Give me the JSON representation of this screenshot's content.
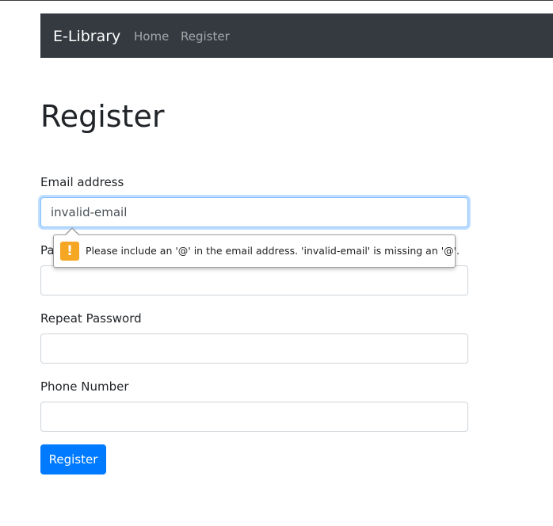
{
  "navbar": {
    "brand": "E-Library",
    "links": [
      "Home",
      "Register"
    ]
  },
  "page": {
    "title": "Register"
  },
  "form": {
    "email": {
      "label": "Email address",
      "value": "invalid-email"
    },
    "password": {
      "label": "Pa",
      "value": ""
    },
    "repeat_password": {
      "label": "Repeat Password",
      "value": ""
    },
    "phone": {
      "label": "Phone Number",
      "value": ""
    },
    "submit_label": "Register"
  },
  "validation": {
    "icon": "warning-icon",
    "message": "Please include an '@' in the email address. 'invalid-email' is missing an '@'."
  },
  "colors": {
    "navbar_bg": "#343a40",
    "primary": "#007bff",
    "warning": "#f5a623"
  }
}
